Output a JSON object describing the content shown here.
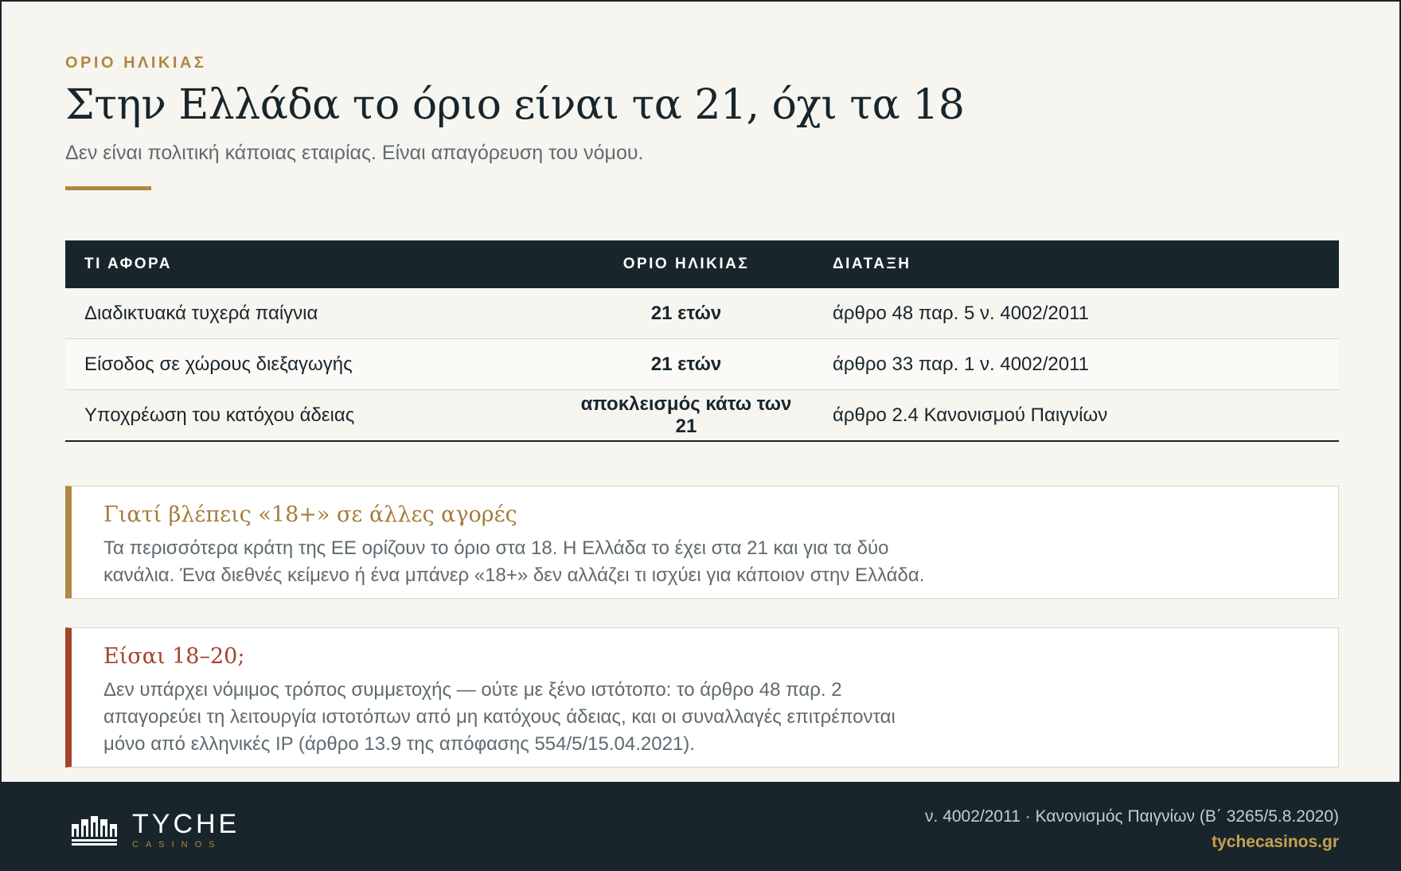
{
  "header": {
    "eyebrow": "ΟΡΙΟ ΗΛΙΚΙΑΣ",
    "title": "Στην Ελλάδα το όριο είναι τα 21, όχι τα 18",
    "subtitle": "Δεν είναι πολιτική κάποιας εταιρίας. Είναι απαγόρευση του νόμου."
  },
  "table": {
    "headers": [
      "ΤΙ ΑΦΟΡΑ",
      "ΟΡΙΟ ΗΛΙΚΙΑΣ",
      "ΔΙΑΤΑΞΗ"
    ],
    "rows": [
      {
        "topic": "Διαδικτυακά τυχερά παίγνια",
        "age": "21 ετών",
        "provision": "άρθρο 48 παρ. 5 ν. 4002/2011"
      },
      {
        "topic": "Είσοδος σε χώρους διεξαγωγής",
        "age": "21 ετών",
        "provision": "άρθρο 33 παρ. 1 ν. 4002/2011"
      },
      {
        "topic": "Υποχρέωση του κατόχου άδειας",
        "age": "αποκλεισμός κάτω των 21",
        "provision": "άρθρο 2.4 Κανονισμού Παιγνίων"
      }
    ]
  },
  "callouts": [
    {
      "title": "Γιατί βλέπεις «18+» σε άλλες αγορές",
      "text": "Τα περισσότερα κράτη της ΕΕ ορίζουν το όριο στα 18. Η Ελλάδα το έχει στα 21 και για τα δύο κανάλια. Ένα διεθνές κείμενο ή ένα μπάνερ «18+» δεν αλλάζει τι ισχύει για κάποιον στην Ελλάδα."
    },
    {
      "title": "Είσαι 18–20;",
      "text": "Δεν υπάρχει νόμιμος τρόπος συμμετοχής — ούτε με ξένο ιστότοπο: το άρθρο 48 παρ. 2 απαγορεύει τη λειτουργία ιστοτόπων από μη κατόχους άδειας, και οι συναλλαγές επιτρέπονται μόνο από ελληνικές IP (άρθρο 13.9 της απόφασης 554/5/15.04.2021)."
    }
  ],
  "footer": {
    "logo_name": "TYCHE",
    "logo_sub": "CASINOS",
    "law_refs": "ν. 4002/2011 · Κανονισμός Παιγνίων (Β΄ 3265/5.8.2020)",
    "site": "tychecasinos.gr"
  },
  "colors": {
    "navy": "#18262c",
    "gold": "#b08742",
    "red": "#a5432c",
    "background": "#f7f5f0"
  },
  "icons": {
    "logo": "castle-skyline-icon"
  }
}
